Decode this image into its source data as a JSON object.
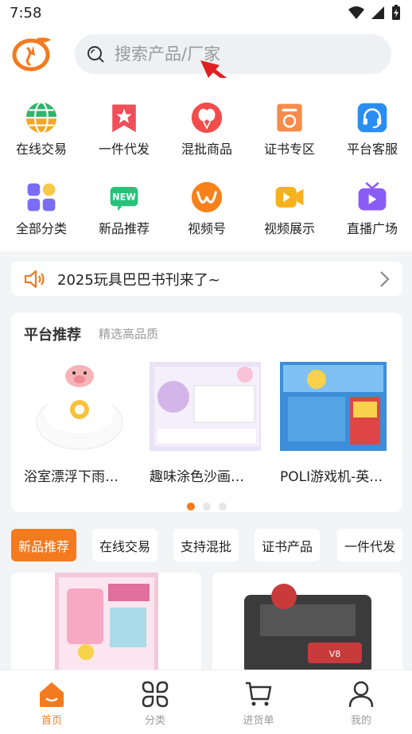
{
  "status_bar": {
    "time": "7:58"
  },
  "search": {
    "placeholder": "搜索产品/厂家"
  },
  "quick_actions": [
    {
      "label": "在线交易",
      "icon": "globe-icon"
    },
    {
      "label": "一件代发",
      "icon": "star-bookmark-icon"
    },
    {
      "label": "混批商品",
      "icon": "balloons-icon"
    },
    {
      "label": "证书专区",
      "icon": "certificate-icon"
    },
    {
      "label": "平台客服",
      "icon": "headset-icon"
    },
    {
      "label": "全部分类",
      "icon": "grid-categories-icon"
    },
    {
      "label": "新品推荐",
      "icon": "new-badge-icon"
    },
    {
      "label": "视频号",
      "icon": "channels-icon"
    },
    {
      "label": "视频展示",
      "icon": "video-play-icon"
    },
    {
      "label": "直播广场",
      "icon": "live-tv-icon"
    }
  ],
  "notice": {
    "text": "2025玩具巴巴书刊来了~"
  },
  "recommend": {
    "title": "平台推荐",
    "subtitle": "精选高品质",
    "items": [
      {
        "name": "浴室漂浮下雨…"
      },
      {
        "name": "趣味涂色沙画…"
      },
      {
        "name": "POLI游戏机-英…"
      }
    ],
    "page_count": 3,
    "active_page": 1
  },
  "tabs": [
    "新品推荐",
    "在线交易",
    "支持混批",
    "证书产品",
    "一件代发"
  ],
  "active_tab": 0,
  "bottom_nav": [
    {
      "label": "首页",
      "icon": "home-icon"
    },
    {
      "label": "分类",
      "icon": "category-icon"
    },
    {
      "label": "进货单",
      "icon": "cart-icon"
    },
    {
      "label": "我的",
      "icon": "user-icon"
    }
  ],
  "colors": {
    "accent": "#f47a1f",
    "annotation": "#e02020"
  }
}
